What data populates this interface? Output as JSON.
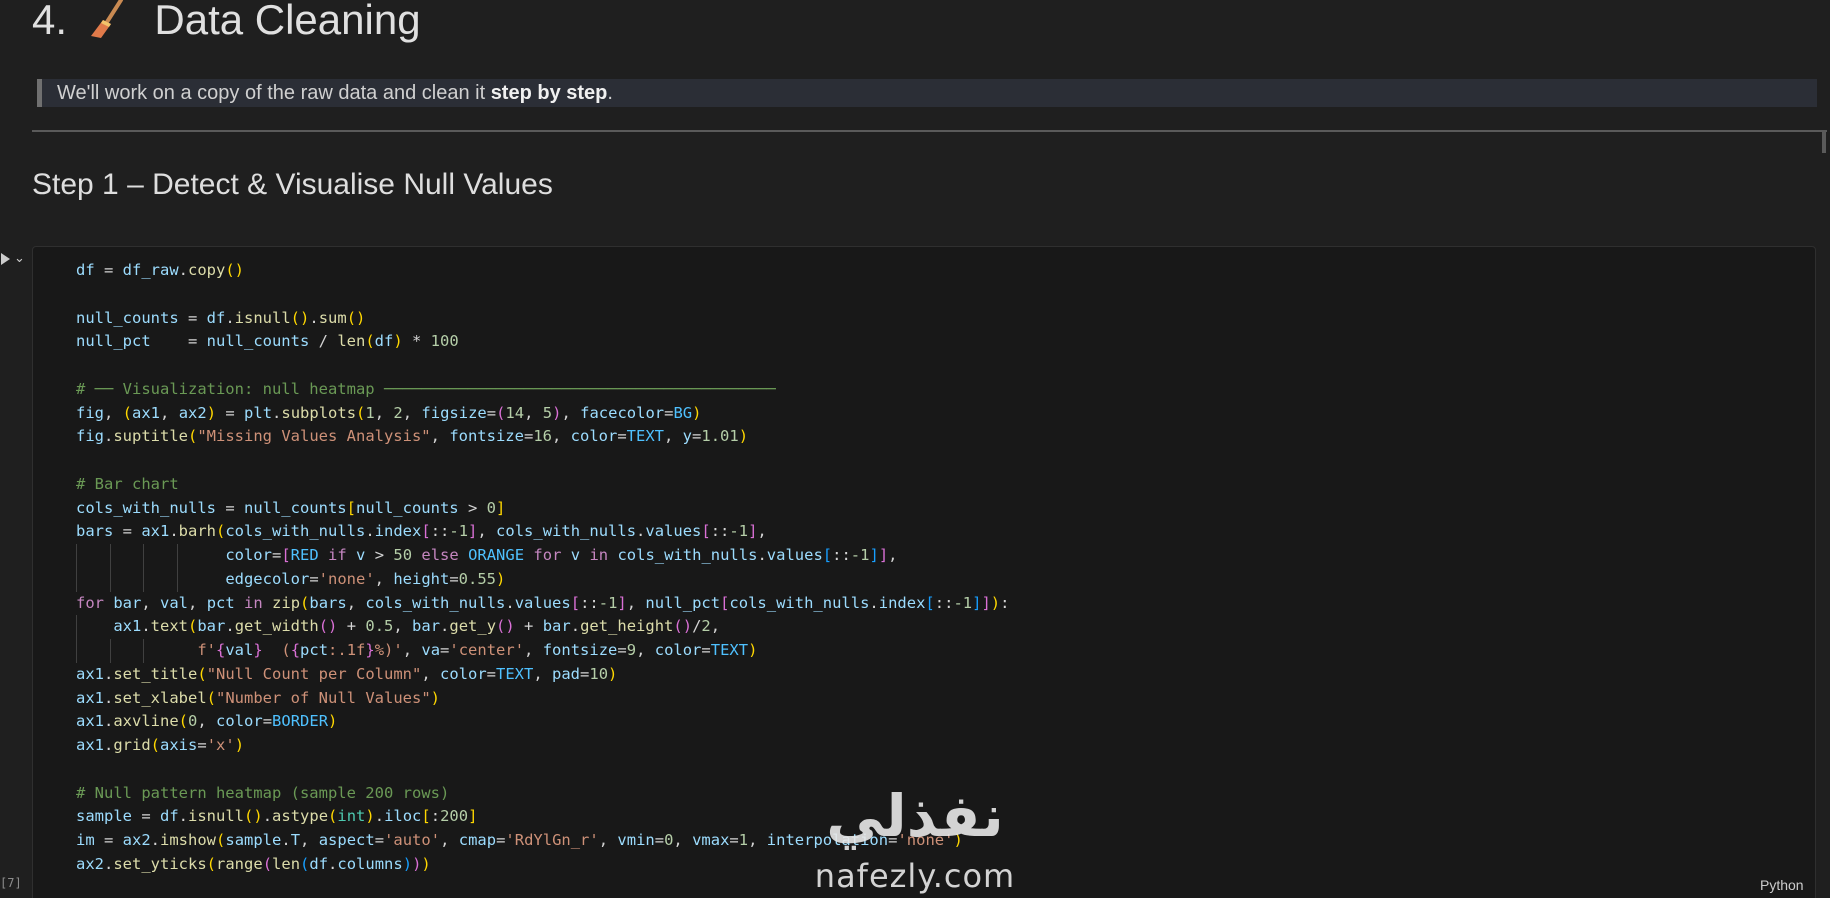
{
  "markdown": {
    "heading_prefix": "4.",
    "heading_icon": "broom-icon",
    "heading_title": "Data Cleaning",
    "quote_before": "We'll work on a copy of the raw data and clean it ",
    "quote_bold": "step by step",
    "quote_after": ".",
    "subheading": "Step 1 – Detect & Visualise Null Values"
  },
  "cell": {
    "execution_count": "[7]",
    "language": "Python",
    "run_icon": "play-icon",
    "collapse_icon": "chevron-down-icon"
  },
  "code_lines": [
    [
      [
        "vr",
        "df"
      ],
      [
        "op",
        " = "
      ],
      [
        "vr",
        "df_raw"
      ],
      [
        "op",
        "."
      ],
      [
        "fn",
        "copy"
      ],
      [
        "br1",
        "()"
      ]
    ],
    [],
    [
      [
        "vr",
        "null_counts"
      ],
      [
        "op",
        " = "
      ],
      [
        "vr",
        "df"
      ],
      [
        "op",
        "."
      ],
      [
        "fn",
        "isnull"
      ],
      [
        "br1",
        "()"
      ],
      [
        "op",
        "."
      ],
      [
        "fn",
        "sum"
      ],
      [
        "br1",
        "()"
      ]
    ],
    [
      [
        "vr",
        "null_pct"
      ],
      [
        "op",
        "    = "
      ],
      [
        "vr",
        "null_counts"
      ],
      [
        "op",
        " / "
      ],
      [
        "fn",
        "len"
      ],
      [
        "br1",
        "("
      ],
      [
        "vr",
        "df"
      ],
      [
        "br1",
        ")"
      ],
      [
        "op",
        " * "
      ],
      [
        "num",
        "100"
      ]
    ],
    [],
    [
      [
        "cm",
        "# ── Visualization: null heatmap ──────────────────────────────────────────"
      ]
    ],
    [
      [
        "vr",
        "fig"
      ],
      [
        "op",
        ", "
      ],
      [
        "br1",
        "("
      ],
      [
        "vr",
        "ax1"
      ],
      [
        "op",
        ", "
      ],
      [
        "vr",
        "ax2"
      ],
      [
        "br1",
        ")"
      ],
      [
        "op",
        " = "
      ],
      [
        "vr",
        "plt"
      ],
      [
        "op",
        "."
      ],
      [
        "fn",
        "subplots"
      ],
      [
        "br1",
        "("
      ],
      [
        "num",
        "1"
      ],
      [
        "op",
        ", "
      ],
      [
        "num",
        "2"
      ],
      [
        "op",
        ", "
      ],
      [
        "vr",
        "figsize"
      ],
      [
        "op",
        "="
      ],
      [
        "br2",
        "("
      ],
      [
        "num",
        "14"
      ],
      [
        "op",
        ", "
      ],
      [
        "num",
        "5"
      ],
      [
        "br2",
        ")"
      ],
      [
        "op",
        ", "
      ],
      [
        "vr",
        "facecolor"
      ],
      [
        "op",
        "="
      ],
      [
        "cs",
        "BG"
      ],
      [
        "br1",
        ")"
      ]
    ],
    [
      [
        "vr",
        "fig"
      ],
      [
        "op",
        "."
      ],
      [
        "fn",
        "suptitle"
      ],
      [
        "br1",
        "("
      ],
      [
        "str",
        "\"Missing Values Analysis\""
      ],
      [
        "op",
        ", "
      ],
      [
        "vr",
        "fontsize"
      ],
      [
        "op",
        "="
      ],
      [
        "num",
        "16"
      ],
      [
        "op",
        ", "
      ],
      [
        "vr",
        "color"
      ],
      [
        "op",
        "="
      ],
      [
        "cs",
        "TEXT"
      ],
      [
        "op",
        ", "
      ],
      [
        "vr",
        "y"
      ],
      [
        "op",
        "="
      ],
      [
        "num",
        "1.01"
      ],
      [
        "br1",
        ")"
      ]
    ],
    [],
    [
      [
        "cm",
        "# Bar chart"
      ]
    ],
    [
      [
        "vr",
        "cols_with_nulls"
      ],
      [
        "op",
        " = "
      ],
      [
        "vr",
        "null_counts"
      ],
      [
        "br1",
        "["
      ],
      [
        "vr",
        "null_counts"
      ],
      [
        "op",
        " > "
      ],
      [
        "num",
        "0"
      ],
      [
        "br1",
        "]"
      ]
    ],
    [
      [
        "vr",
        "bars"
      ],
      [
        "op",
        " = "
      ],
      [
        "vr",
        "ax1"
      ],
      [
        "op",
        "."
      ],
      [
        "fn",
        "barh"
      ],
      [
        "br1",
        "("
      ],
      [
        "vr",
        "cols_with_nulls"
      ],
      [
        "op",
        "."
      ],
      [
        "vr",
        "index"
      ],
      [
        "br2",
        "["
      ],
      [
        "op",
        "::"
      ],
      [
        "num",
        "-1"
      ],
      [
        "br2",
        "]"
      ],
      [
        "op",
        ", "
      ],
      [
        "vr",
        "cols_with_nulls"
      ],
      [
        "op",
        "."
      ],
      [
        "vr",
        "values"
      ],
      [
        "br2",
        "["
      ],
      [
        "op",
        "::"
      ],
      [
        "num",
        "-1"
      ],
      [
        "br2",
        "]"
      ],
      [
        "op",
        ","
      ]
    ],
    [
      [
        "op",
        "                "
      ],
      [
        "vr",
        "color"
      ],
      [
        "op",
        "="
      ],
      [
        "br2",
        "["
      ],
      [
        "cs",
        "RED"
      ],
      [
        "op",
        " "
      ],
      [
        "kw",
        "if"
      ],
      [
        "op",
        " "
      ],
      [
        "vr",
        "v"
      ],
      [
        "op",
        " > "
      ],
      [
        "num",
        "50"
      ],
      [
        "op",
        " "
      ],
      [
        "kw",
        "else"
      ],
      [
        "op",
        " "
      ],
      [
        "cs",
        "ORANGE"
      ],
      [
        "op",
        " "
      ],
      [
        "kw",
        "for"
      ],
      [
        "op",
        " "
      ],
      [
        "vr",
        "v"
      ],
      [
        "op",
        " "
      ],
      [
        "kw",
        "in"
      ],
      [
        "op",
        " "
      ],
      [
        "vr",
        "cols_with_nulls"
      ],
      [
        "op",
        "."
      ],
      [
        "vr",
        "values"
      ],
      [
        "br3",
        "["
      ],
      [
        "op",
        "::"
      ],
      [
        "num",
        "-1"
      ],
      [
        "br3",
        "]"
      ],
      [
        "br2",
        "]"
      ],
      [
        "op",
        ","
      ]
    ],
    [
      [
        "op",
        "                "
      ],
      [
        "vr",
        "edgecolor"
      ],
      [
        "op",
        "="
      ],
      [
        "str",
        "'none'"
      ],
      [
        "op",
        ", "
      ],
      [
        "vr",
        "height"
      ],
      [
        "op",
        "="
      ],
      [
        "num",
        "0.55"
      ],
      [
        "br1",
        ")"
      ]
    ],
    [
      [
        "kw",
        "for"
      ],
      [
        "op",
        " "
      ],
      [
        "vr",
        "bar"
      ],
      [
        "op",
        ", "
      ],
      [
        "vr",
        "val"
      ],
      [
        "op",
        ", "
      ],
      [
        "vr",
        "pct"
      ],
      [
        "op",
        " "
      ],
      [
        "kw",
        "in"
      ],
      [
        "op",
        " "
      ],
      [
        "fn",
        "zip"
      ],
      [
        "br1",
        "("
      ],
      [
        "vr",
        "bars"
      ],
      [
        "op",
        ", "
      ],
      [
        "vr",
        "cols_with_nulls"
      ],
      [
        "op",
        "."
      ],
      [
        "vr",
        "values"
      ],
      [
        "br2",
        "["
      ],
      [
        "op",
        "::"
      ],
      [
        "num",
        "-1"
      ],
      [
        "br2",
        "]"
      ],
      [
        "op",
        ", "
      ],
      [
        "vr",
        "null_pct"
      ],
      [
        "br2",
        "["
      ],
      [
        "vr",
        "cols_with_nulls"
      ],
      [
        "op",
        "."
      ],
      [
        "vr",
        "index"
      ],
      [
        "br3",
        "["
      ],
      [
        "op",
        "::"
      ],
      [
        "num",
        "-1"
      ],
      [
        "br3",
        "]"
      ],
      [
        "br2",
        "]"
      ],
      [
        "br1",
        ")"
      ],
      [
        "op",
        ":"
      ]
    ],
    [
      [
        "op",
        "    "
      ],
      [
        "vr",
        "ax1"
      ],
      [
        "op",
        "."
      ],
      [
        "fn",
        "text"
      ],
      [
        "br1",
        "("
      ],
      [
        "vr",
        "bar"
      ],
      [
        "op",
        "."
      ],
      [
        "fn",
        "get_width"
      ],
      [
        "br2",
        "()"
      ],
      [
        "op",
        " + "
      ],
      [
        "num",
        "0.5"
      ],
      [
        "op",
        ", "
      ],
      [
        "vr",
        "bar"
      ],
      [
        "op",
        "."
      ],
      [
        "fn",
        "get_y"
      ],
      [
        "br2",
        "()"
      ],
      [
        "op",
        " + "
      ],
      [
        "vr",
        "bar"
      ],
      [
        "op",
        "."
      ],
      [
        "fn",
        "get_height"
      ],
      [
        "br2",
        "()"
      ],
      [
        "op",
        "/"
      ],
      [
        "num",
        "2"
      ],
      [
        "op",
        ","
      ]
    ],
    [
      [
        "op",
        "             "
      ],
      [
        "str",
        "f'"
      ],
      [
        "br2",
        "{"
      ],
      [
        "vr",
        "val"
      ],
      [
        "br2",
        "}"
      ],
      [
        "str",
        "  ("
      ],
      [
        "br2",
        "{"
      ],
      [
        "vr",
        "pct"
      ],
      [
        "str",
        ":.1f"
      ],
      [
        "br2",
        "}"
      ],
      [
        "str",
        "%)'"
      ],
      [
        "op",
        ", "
      ],
      [
        "vr",
        "va"
      ],
      [
        "op",
        "="
      ],
      [
        "str",
        "'center'"
      ],
      [
        "op",
        ", "
      ],
      [
        "vr",
        "fontsize"
      ],
      [
        "op",
        "="
      ],
      [
        "num",
        "9"
      ],
      [
        "op",
        ", "
      ],
      [
        "vr",
        "color"
      ],
      [
        "op",
        "="
      ],
      [
        "cs",
        "TEXT"
      ],
      [
        "br1",
        ")"
      ]
    ],
    [
      [
        "vr",
        "ax1"
      ],
      [
        "op",
        "."
      ],
      [
        "fn",
        "set_title"
      ],
      [
        "br1",
        "("
      ],
      [
        "str",
        "\"Null Count per Column\""
      ],
      [
        "op",
        ", "
      ],
      [
        "vr",
        "color"
      ],
      [
        "op",
        "="
      ],
      [
        "cs",
        "TEXT"
      ],
      [
        "op",
        ", "
      ],
      [
        "vr",
        "pad"
      ],
      [
        "op",
        "="
      ],
      [
        "num",
        "10"
      ],
      [
        "br1",
        ")"
      ]
    ],
    [
      [
        "vr",
        "ax1"
      ],
      [
        "op",
        "."
      ],
      [
        "fn",
        "set_xlabel"
      ],
      [
        "br1",
        "("
      ],
      [
        "str",
        "\"Number of Null Values\""
      ],
      [
        "br1",
        ")"
      ]
    ],
    [
      [
        "vr",
        "ax1"
      ],
      [
        "op",
        "."
      ],
      [
        "fn",
        "axvline"
      ],
      [
        "br1",
        "("
      ],
      [
        "num",
        "0"
      ],
      [
        "op",
        ", "
      ],
      [
        "vr",
        "color"
      ],
      [
        "op",
        "="
      ],
      [
        "cs",
        "BORDER"
      ],
      [
        "br1",
        ")"
      ]
    ],
    [
      [
        "vr",
        "ax1"
      ],
      [
        "op",
        "."
      ],
      [
        "fn",
        "grid"
      ],
      [
        "br1",
        "("
      ],
      [
        "vr",
        "axis"
      ],
      [
        "op",
        "="
      ],
      [
        "str",
        "'x'"
      ],
      [
        "br1",
        ")"
      ]
    ],
    [],
    [
      [
        "cm",
        "# Null pattern heatmap (sample 200 rows)"
      ]
    ],
    [
      [
        "vr",
        "sample"
      ],
      [
        "op",
        " = "
      ],
      [
        "vr",
        "df"
      ],
      [
        "op",
        "."
      ],
      [
        "fn",
        "isnull"
      ],
      [
        "br1",
        "()"
      ],
      [
        "op",
        "."
      ],
      [
        "fn",
        "astype"
      ],
      [
        "br1",
        "("
      ],
      [
        "bi",
        "int"
      ],
      [
        "br1",
        ")"
      ],
      [
        "op",
        "."
      ],
      [
        "vr",
        "iloc"
      ],
      [
        "br1",
        "["
      ],
      [
        "op",
        ":"
      ],
      [
        "num",
        "200"
      ],
      [
        "br1",
        "]"
      ]
    ],
    [
      [
        "vr",
        "im"
      ],
      [
        "op",
        " = "
      ],
      [
        "vr",
        "ax2"
      ],
      [
        "op",
        "."
      ],
      [
        "fn",
        "imshow"
      ],
      [
        "br1",
        "("
      ],
      [
        "vr",
        "sample"
      ],
      [
        "op",
        "."
      ],
      [
        "vr",
        "T"
      ],
      [
        "op",
        ", "
      ],
      [
        "vr",
        "aspect"
      ],
      [
        "op",
        "="
      ],
      [
        "str",
        "'auto'"
      ],
      [
        "op",
        ", "
      ],
      [
        "vr",
        "cmap"
      ],
      [
        "op",
        "="
      ],
      [
        "str",
        "'RdYlGn_r'"
      ],
      [
        "op",
        ", "
      ],
      [
        "vr",
        "vmin"
      ],
      [
        "op",
        "="
      ],
      [
        "num",
        "0"
      ],
      [
        "op",
        ", "
      ],
      [
        "vr",
        "vmax"
      ],
      [
        "op",
        "="
      ],
      [
        "num",
        "1"
      ],
      [
        "op",
        ", "
      ],
      [
        "vr",
        "interpolation"
      ],
      [
        "op",
        "="
      ],
      [
        "str",
        "'none'"
      ],
      [
        "br1",
        ")"
      ]
    ],
    [
      [
        "vr",
        "ax2"
      ],
      [
        "op",
        "."
      ],
      [
        "fn",
        "set_yticks"
      ],
      [
        "br1",
        "("
      ],
      [
        "fn",
        "range"
      ],
      [
        "br2",
        "("
      ],
      [
        "fn",
        "len"
      ],
      [
        "br3",
        "("
      ],
      [
        "vr",
        "df"
      ],
      [
        "op",
        "."
      ],
      [
        "vr",
        "columns"
      ],
      [
        "br3",
        ")"
      ],
      [
        "br2",
        ")"
      ],
      [
        "br1",
        ")"
      ]
    ]
  ],
  "watermark": {
    "arabic": "نفذلي",
    "latin": "nafezly.com"
  }
}
